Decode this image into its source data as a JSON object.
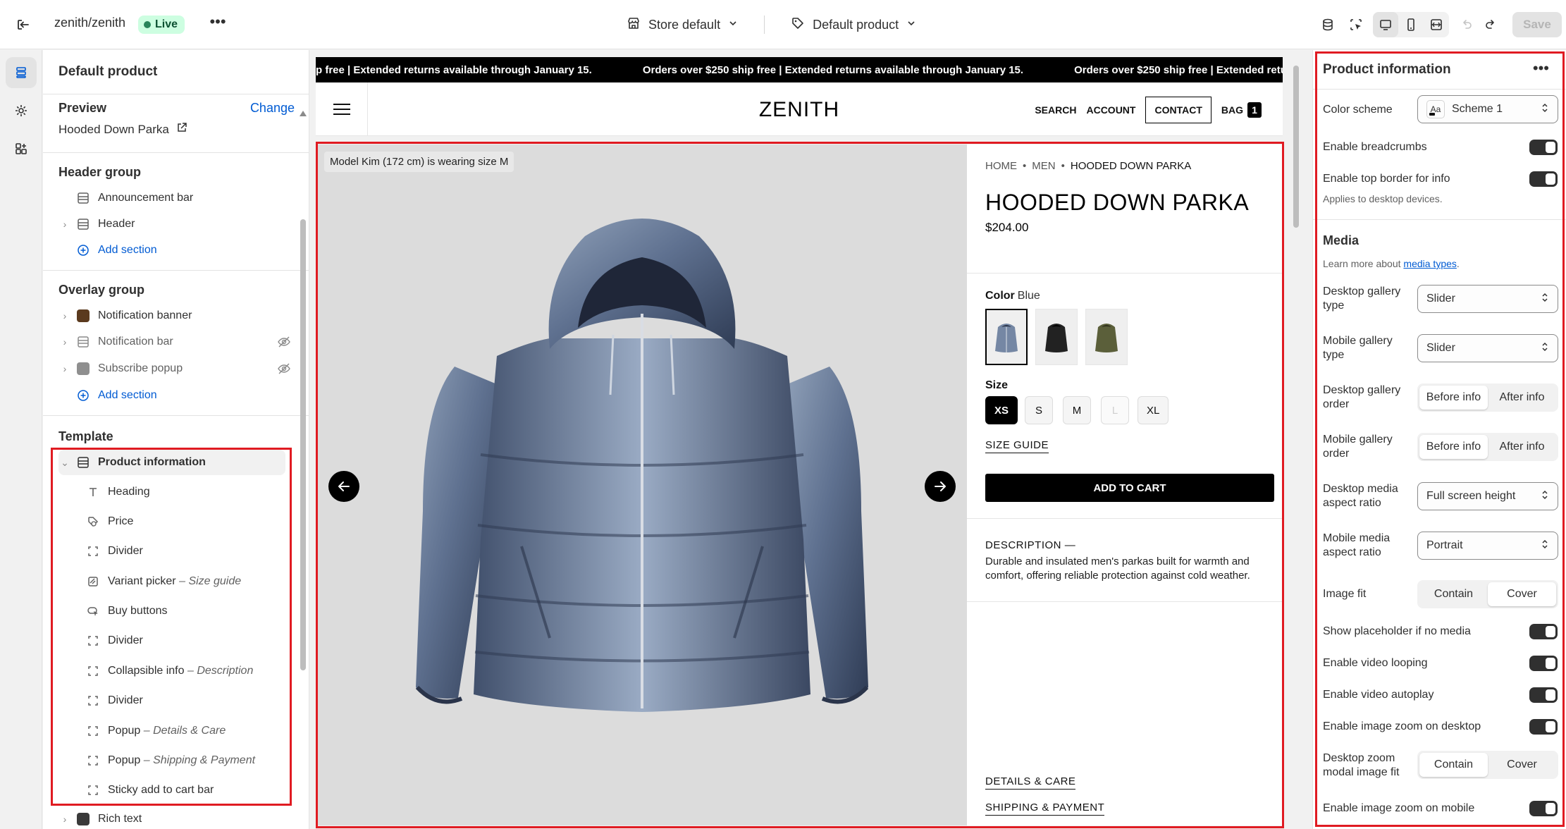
{
  "topbar": {
    "store": "zenith/zenith",
    "live": "Live",
    "store_selector": "Store default",
    "product_selector": "Default product",
    "save": "Save"
  },
  "left": {
    "title": "Default product",
    "preview_label": "Preview",
    "change": "Change",
    "preview_item": "Hooded Down Parka",
    "header_group": "Header group",
    "header_items": [
      "Announcement bar",
      "Header"
    ],
    "add_section": "Add section",
    "overlay_group": "Overlay group",
    "overlay_items": [
      "Notification banner",
      "Notification bar",
      "Subscribe popup"
    ],
    "template": "Template",
    "template_section": "Product information",
    "blocks": [
      {
        "name": "Heading",
        "note": ""
      },
      {
        "name": "Price",
        "note": ""
      },
      {
        "name": "Divider",
        "note": ""
      },
      {
        "name": "Variant picker",
        "note": "– Size guide"
      },
      {
        "name": "Buy buttons",
        "note": ""
      },
      {
        "name": "Divider",
        "note": ""
      },
      {
        "name": "Collapsible info",
        "note": "– Description"
      },
      {
        "name": "Divider",
        "note": ""
      },
      {
        "name": "Popup",
        "note": "– Details & Care"
      },
      {
        "name": "Popup",
        "note": "– Shipping & Payment"
      },
      {
        "name": "Sticky add to cart bar",
        "note": ""
      }
    ],
    "next_section": "Rich text"
  },
  "preview": {
    "announcement": [
      "p free | Extended returns available through January 15.",
      "Orders over $250 ship free | Extended returns available through January 15.",
      "Orders over $250 ship free | Extended returns available throu"
    ],
    "logo": "ZENITH",
    "nav": {
      "search": "SEARCH",
      "account": "ACCOUNT",
      "contact": "CONTACT",
      "bag": "BAG",
      "bag_count": "1"
    },
    "media_note": "Model Kim (172 cm) is wearing size M",
    "breadcrumb": [
      "HOME",
      "MEN",
      "HOODED DOWN PARKA"
    ],
    "title": "HOODED DOWN PARKA",
    "price": "$204.00",
    "color_label": "Color",
    "color_value": "Blue",
    "size_label": "Size",
    "sizes": [
      "XS",
      "S",
      "M",
      "L",
      "XL"
    ],
    "size_guide": "SIZE GUIDE",
    "add_to_cart": "ADD TO CART",
    "description_heading": "DESCRIPTION",
    "description": "Durable and insulated men's parkas built for warmth and comfort, offering reliable protection against cold weather.",
    "details_care": "DETAILS & CARE",
    "shipping_payment": "SHIPPING & PAYMENT"
  },
  "right": {
    "title": "Product information",
    "color_scheme_label": "Color scheme",
    "color_scheme_value": "Scheme 1",
    "breadcrumbs_label": "Enable breadcrumbs",
    "top_border_label": "Enable top border for info",
    "top_border_help": "Applies to desktop devices.",
    "media_heading": "Media",
    "media_help_prefix": "Learn more about ",
    "media_help_link": "media types",
    "media_help_suffix": ".",
    "desktop_gallery_type_label": "Desktop gallery type",
    "desktop_gallery_type_value": "Slider",
    "mobile_gallery_type_label": "Mobile gallery type",
    "mobile_gallery_type_value": "Slider",
    "desktop_gallery_order_label": "Desktop gallery order",
    "mobile_gallery_order_label": "Mobile gallery order",
    "order_before": "Before info",
    "order_after": "After info",
    "desktop_aspect_label": "Desktop media aspect ratio",
    "desktop_aspect_value": "Full screen height",
    "mobile_aspect_label": "Mobile media aspect ratio",
    "mobile_aspect_value": "Portrait",
    "image_fit_label": "Image fit",
    "contain": "Contain",
    "cover": "Cover",
    "placeholder_label": "Show placeholder if no media",
    "looping_label": "Enable video looping",
    "autoplay_label": "Enable video autoplay",
    "zoom_desktop_label": "Enable image zoom on desktop",
    "zoom_modal_label": "Desktop zoom modal image fit",
    "zoom_mobile_label": "Enable image zoom on mobile"
  }
}
